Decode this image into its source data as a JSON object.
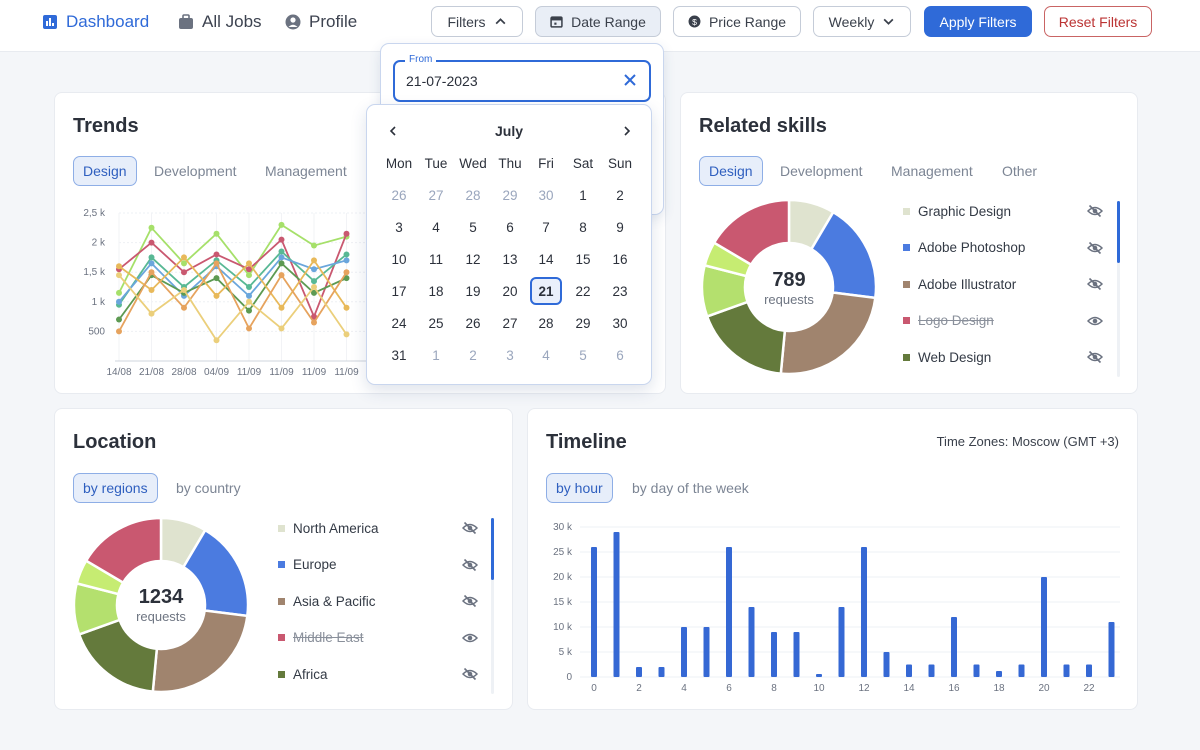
{
  "nav": {
    "dashboard": "Dashboard",
    "all_jobs": "All Jobs",
    "profile": "Profile"
  },
  "toolbar": {
    "filters": "Filters",
    "date_range": "Date Range",
    "price_range": "Price Range",
    "weekly": "Weekly",
    "apply": "Apply Filters",
    "reset": "Reset Filters"
  },
  "date_picker": {
    "from_label": "From",
    "from_value": "21-07-2023",
    "month": "July",
    "weekdays": [
      "Mon",
      "Tue",
      "Wed",
      "Thu",
      "Fri",
      "Sat",
      "Sun"
    ],
    "weeks": [
      [
        "26",
        "27",
        "28",
        "29",
        "30",
        "1",
        "2"
      ],
      [
        "3",
        "4",
        "5",
        "6",
        "7",
        "8",
        "9"
      ],
      [
        "10",
        "11",
        "12",
        "13",
        "14",
        "15",
        "16"
      ],
      [
        "17",
        "18",
        "19",
        "20",
        "21",
        "22",
        "23"
      ],
      [
        "24",
        "25",
        "26",
        "27",
        "28",
        "29",
        "30"
      ],
      [
        "31",
        "1",
        "2",
        "3",
        "4",
        "5",
        "6"
      ]
    ],
    "selected": "21"
  },
  "trends": {
    "title": "Trends",
    "tabs": [
      "Design",
      "Development",
      "Management"
    ],
    "active_tab": "Design"
  },
  "related_skills": {
    "title": "Related skills",
    "tabs": [
      "Design",
      "Development",
      "Management",
      "Other"
    ],
    "total": "789",
    "total_label": "requests",
    "items": [
      {
        "label": "Graphic Design",
        "color": "#dfe3cf",
        "visible": false,
        "struck": false
      },
      {
        "label": "Adobe Photoshop",
        "color": "#4b7be0",
        "visible": false,
        "struck": false
      },
      {
        "label": "Adobe Illustrator",
        "color": "#a0846e",
        "visible": false,
        "struck": false
      },
      {
        "label": "Logo Design",
        "color": "#c95870",
        "visible": true,
        "struck": true
      },
      {
        "label": "Web Design",
        "color": "#647a3c",
        "visible": false,
        "struck": false
      }
    ]
  },
  "location": {
    "title": "Location",
    "tabs": [
      "by regions",
      "by country"
    ],
    "total": "1234",
    "total_label": "requests",
    "items": [
      {
        "label": "North America",
        "color": "#dfe3cf",
        "visible": false,
        "struck": false
      },
      {
        "label": "Europe",
        "color": "#4b7be0",
        "visible": false,
        "struck": false
      },
      {
        "label": "Asia & Pacific",
        "color": "#a0846e",
        "visible": false,
        "struck": false
      },
      {
        "label": "Middle East",
        "color": "#c95870",
        "visible": true,
        "struck": true
      },
      {
        "label": "Africa",
        "color": "#647a3c",
        "visible": false,
        "struck": false
      }
    ]
  },
  "timeline": {
    "title": "Timeline",
    "tabs": [
      "by hour",
      "by day of the week"
    ],
    "timezone": "Time Zones: Moscow (GMT +3)"
  },
  "chart_data": [
    {
      "type": "line",
      "title": "Trends",
      "x": [
        "14/08",
        "21/08",
        "28/08",
        "04/09",
        "11/09",
        "11/09",
        "11/09",
        "11/09"
      ],
      "yticks": [
        "2,5 k",
        "2 k",
        "1,5 k",
        "1 k",
        "500"
      ],
      "ylim": [
        0,
        2.5
      ],
      "series": [
        {
          "color": "#a6e06a",
          "values": [
            1.15,
            2.25,
            1.65,
            2.15,
            1.45,
            2.3,
            1.95,
            2.1
          ]
        },
        {
          "color": "#c95870",
          "values": [
            1.55,
            2.0,
            1.5,
            1.8,
            1.55,
            2.05,
            0.75,
            2.15
          ]
        },
        {
          "color": "#58b894",
          "values": [
            0.95,
            1.75,
            1.25,
            1.7,
            1.25,
            1.85,
            1.35,
            1.8
          ]
        },
        {
          "color": "#6aa6dc",
          "values": [
            1.0,
            1.65,
            1.1,
            1.6,
            1.1,
            1.75,
            1.55,
            1.7
          ]
        },
        {
          "color": "#5d9a52",
          "values": [
            0.7,
            1.45,
            1.15,
            1.4,
            0.85,
            1.65,
            1.15,
            1.4
          ]
        },
        {
          "color": "#e8b95a",
          "values": [
            1.6,
            1.2,
            1.75,
            1.1,
            1.65,
            0.9,
            1.7,
            0.9
          ]
        },
        {
          "color": "#e6a35e",
          "values": [
            0.5,
            1.5,
            0.9,
            1.65,
            0.55,
            1.45,
            0.65,
            1.5
          ]
        },
        {
          "color": "#ebcf7b",
          "values": [
            1.45,
            0.8,
            1.2,
            0.35,
            1.0,
            0.55,
            1.25,
            0.45
          ]
        }
      ]
    },
    {
      "type": "pie",
      "title": "Related skills",
      "labels": [
        "Graphic Design",
        "Adobe Photoshop",
        "Adobe Illustrator",
        "Web Design",
        "other green",
        "other pink",
        "Logo Design"
      ],
      "colors": [
        "#dfe3cf",
        "#4b7be0",
        "#a0846e",
        "#647a3c",
        "#b4e06e",
        "#c6ec72",
        "#c95870"
      ],
      "values": [
        0.085,
        0.185,
        0.245,
        0.18,
        0.095,
        0.045,
        0.165
      ]
    },
    {
      "type": "pie",
      "title": "Location",
      "labels": [
        "North America",
        "Europe",
        "Asia & Pacific",
        "Africa",
        "other green",
        "other pink",
        "Middle East"
      ],
      "colors": [
        "#dfe3cf",
        "#4b7be0",
        "#a0846e",
        "#647a3c",
        "#b4e06e",
        "#c6ec72",
        "#c95870"
      ],
      "values": [
        0.085,
        0.185,
        0.245,
        0.18,
        0.095,
        0.045,
        0.165
      ]
    },
    {
      "type": "bar",
      "title": "Timeline",
      "categories": [
        0,
        1,
        2,
        3,
        4,
        5,
        6,
        7,
        8,
        9,
        10,
        11,
        12,
        13,
        14,
        15,
        16,
        17,
        18,
        19,
        20,
        21,
        22,
        23
      ],
      "values": [
        26,
        29,
        2,
        2,
        10,
        10,
        26,
        14,
        9,
        9,
        0.6,
        14,
        26,
        5,
        2.5,
        2.5,
        12,
        2.5,
        1.2,
        2.5,
        20,
        2.5,
        2.5,
        11
      ],
      "yticks": [
        "30 k",
        "25 k",
        "20 k",
        "15 k",
        "10 k",
        "5 k",
        "0"
      ],
      "xticks": [
        "0",
        "2",
        "4",
        "6",
        "8",
        "10",
        "12",
        "14",
        "16",
        "18",
        "20",
        "22"
      ]
    }
  ]
}
